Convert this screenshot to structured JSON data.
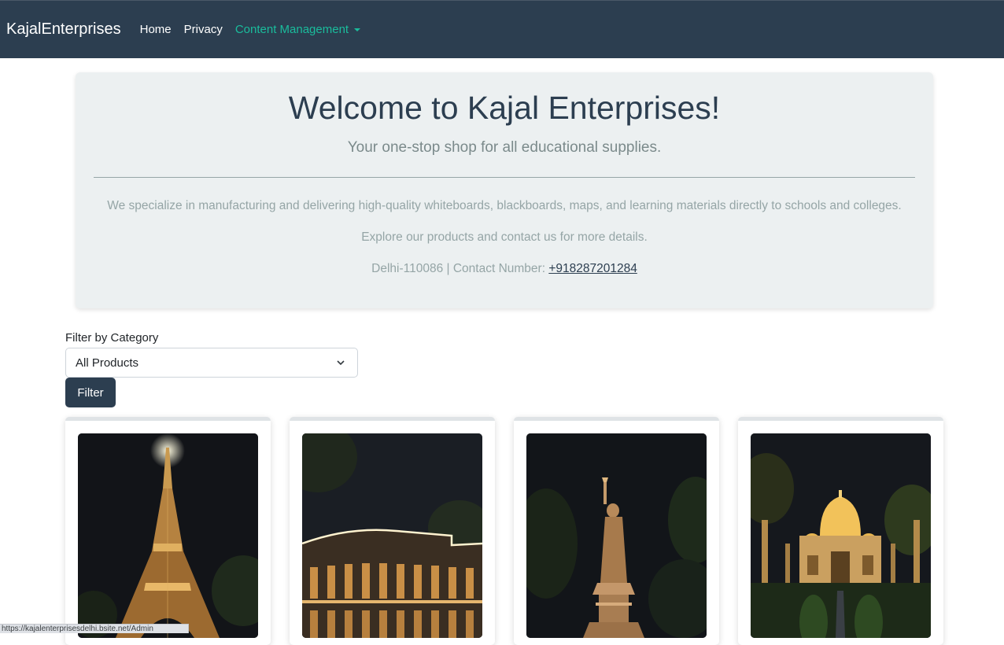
{
  "navbar": {
    "brand": "KajalEnterprises",
    "links": [
      {
        "label": "Home"
      },
      {
        "label": "Privacy"
      },
      {
        "label": "Content Management"
      }
    ]
  },
  "jumbotron": {
    "title": "Welcome to Kajal Enterprises!",
    "subtitle": "Your one-stop shop for all educational supplies.",
    "description": "We specialize in manufacturing and delivering high-quality whiteboards, blackboards, maps, and learning materials directly to schools and colleges.",
    "explore": "Explore our products and contact us for more details.",
    "location_prefix": "Delhi-110086 | Contact Number: ",
    "phone": "+918287201284"
  },
  "filter": {
    "label": "Filter by Category",
    "selected": "All Products",
    "button_label": "Filter"
  },
  "products": [
    {
      "image": "eiffel-tower-night-photo"
    },
    {
      "image": "colosseum-night-photo"
    },
    {
      "image": "statue-of-liberty-night-photo"
    },
    {
      "image": "taj-mahal-night-photo"
    }
  ],
  "statusbar": {
    "url": "https://kajalenterprisesdelhi.bsite.net/Admin"
  },
  "colors": {
    "navbar_bg": "#2c3e50",
    "accent": "#1abc9c",
    "jumbotron_bg": "#ecf0f1",
    "muted_text": "#95a5a6"
  }
}
